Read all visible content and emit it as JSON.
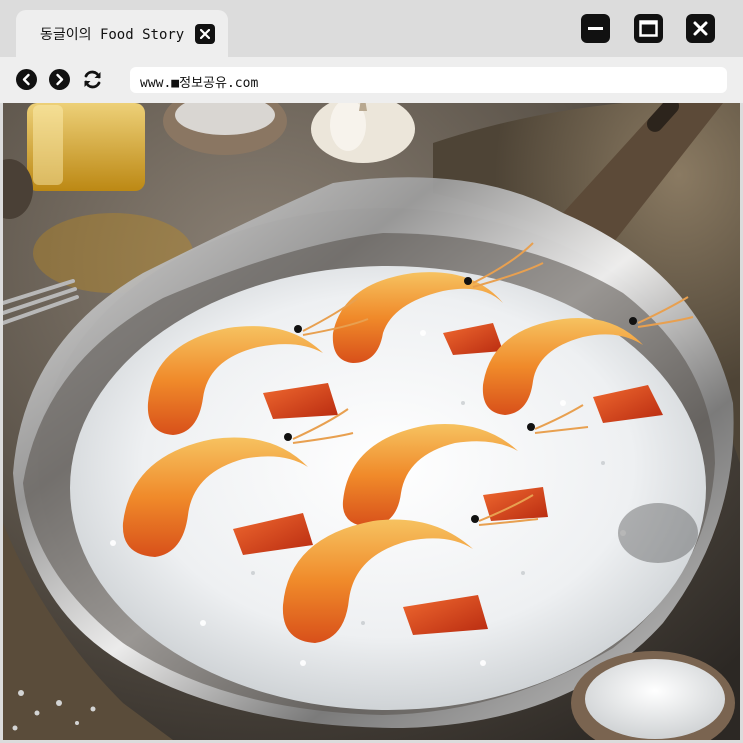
{
  "tab": {
    "title": "동글이의 Food Story"
  },
  "window_controls": {
    "minimize": "minimize",
    "maximize": "maximize",
    "close": "close"
  },
  "nav": {
    "back": "back",
    "forward": "forward",
    "reload": "reload"
  },
  "address_bar": {
    "url": "www.■정보공유.com"
  },
  "content": {
    "image_subject": "salt-baked shrimp in foil-lined pan"
  },
  "colors": {
    "chrome_bg": "#dcdcdc",
    "tab_bg": "#eeeeee",
    "icon_dark": "#111111",
    "address_bg": "#ffffff"
  }
}
